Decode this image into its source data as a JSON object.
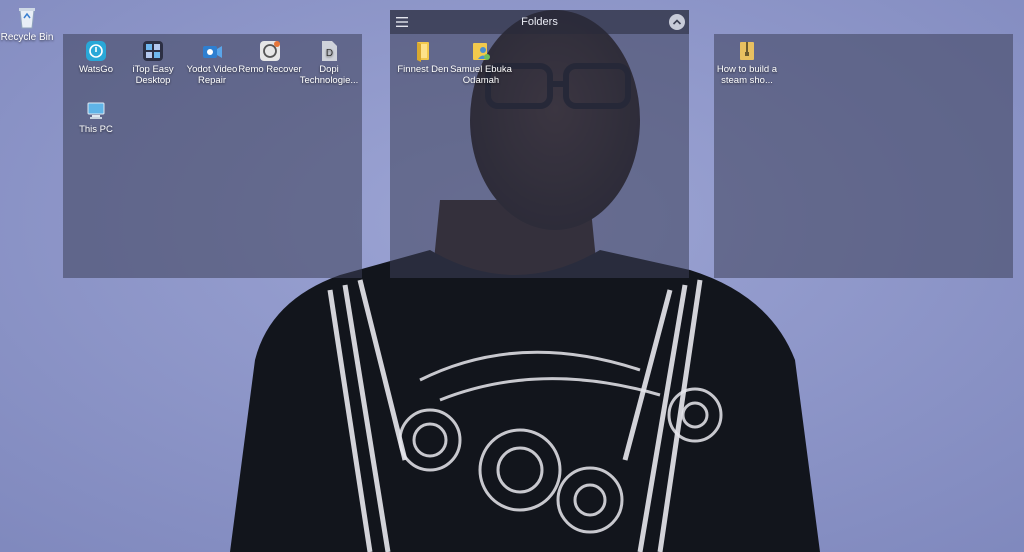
{
  "desktop": {
    "recycle_bin": {
      "label": "Recycle Bin",
      "icon": "recycle-bin-icon"
    }
  },
  "fences": {
    "left": {
      "items": [
        {
          "label": "WatsGo",
          "icon": "watsgo-app-icon",
          "color": "#29a8d8"
        },
        {
          "label": "iTop Easy Desktop",
          "icon": "itop-easy-desktop-icon",
          "color": "#3b3f57"
        },
        {
          "label": "Yodot Video Repair",
          "icon": "yodot-video-repair-icon",
          "color": "#2f7fd0"
        },
        {
          "label": "Remo Recover",
          "icon": "remo-recover-icon",
          "color": "#e6e6e6"
        },
        {
          "label": "Dopi Technologie...",
          "icon": "dopi-document-icon",
          "color": "#cfd2da"
        },
        {
          "label": "This PC",
          "icon": "this-pc-icon",
          "color": "#5fb4e8"
        }
      ]
    },
    "center": {
      "title": "Folders",
      "items": [
        {
          "label": "Finnest Den",
          "icon": "folder-icon",
          "color": "#f2c94c"
        },
        {
          "label": "Samuel Ebuka Odamah",
          "icon": "user-folder-icon",
          "color": "#f2c94c"
        }
      ]
    },
    "right": {
      "items": [
        {
          "label": "How to build a steam sho...",
          "icon": "zip-folder-icon",
          "color": "#e8c060"
        }
      ]
    }
  }
}
